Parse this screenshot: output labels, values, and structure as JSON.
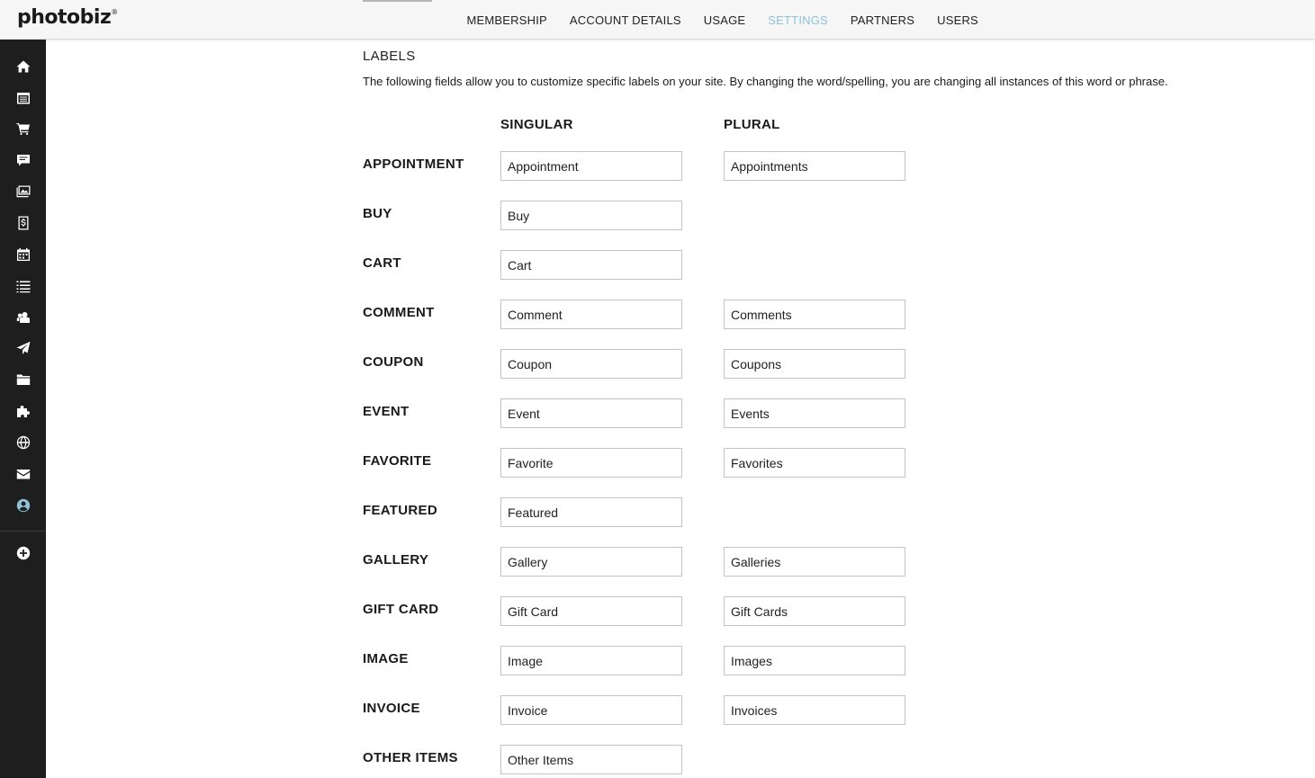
{
  "app": {
    "logo_text": "photobiz",
    "logo_mark": "®"
  },
  "top_nav": {
    "tabs": [
      {
        "label": "MEMBERSHIP",
        "active": false
      },
      {
        "label": "ACCOUNT DETAILS",
        "active": false
      },
      {
        "label": "USAGE",
        "active": false
      },
      {
        "label": "SETTINGS",
        "active": true
      },
      {
        "label": "PARTNERS",
        "active": false
      },
      {
        "label": "USERS",
        "active": false
      }
    ],
    "active_color": "#8dc2d9"
  },
  "sidebar": {
    "icons": [
      "home-icon",
      "calendar-list-icon",
      "cart-icon",
      "comment-icon",
      "gallery-icon",
      "invoice-icon",
      "event-calendar-icon",
      "list-icon",
      "users-icon",
      "send-icon",
      "folder-icon",
      "puzzle-icon",
      "globe-icon",
      "mail-icon",
      "account-icon",
      "add-icon"
    ]
  },
  "labels": {
    "title": "LABELS",
    "description": "The following fields allow you to customize specific labels on your site. By changing the word/spelling, you are changing all instances of this word or phrase.",
    "col_singular": "SINGULAR",
    "col_plural": "PLURAL",
    "rows": [
      {
        "label": "APPOINTMENT",
        "singular": "Appointment",
        "plural": "Appointments"
      },
      {
        "label": "BUY",
        "singular": "Buy",
        "plural": null
      },
      {
        "label": "CART",
        "singular": "Cart",
        "plural": null
      },
      {
        "label": "COMMENT",
        "singular": "Comment",
        "plural": "Comments"
      },
      {
        "label": "COUPON",
        "singular": "Coupon",
        "plural": "Coupons"
      },
      {
        "label": "EVENT",
        "singular": "Event",
        "plural": "Events"
      },
      {
        "label": "FAVORITE",
        "singular": "Favorite",
        "plural": "Favorites"
      },
      {
        "label": "FEATURED",
        "singular": "Featured",
        "plural": null
      },
      {
        "label": "GALLERY",
        "singular": "Gallery",
        "plural": "Galleries"
      },
      {
        "label": "GIFT CARD",
        "singular": "Gift Card",
        "plural": "Gift Cards"
      },
      {
        "label": "IMAGE",
        "singular": "Image",
        "plural": "Images"
      },
      {
        "label": "INVOICE",
        "singular": "Invoice",
        "plural": "Invoices"
      },
      {
        "label": "OTHER ITEMS",
        "singular": "Other Items",
        "plural": null
      }
    ]
  }
}
